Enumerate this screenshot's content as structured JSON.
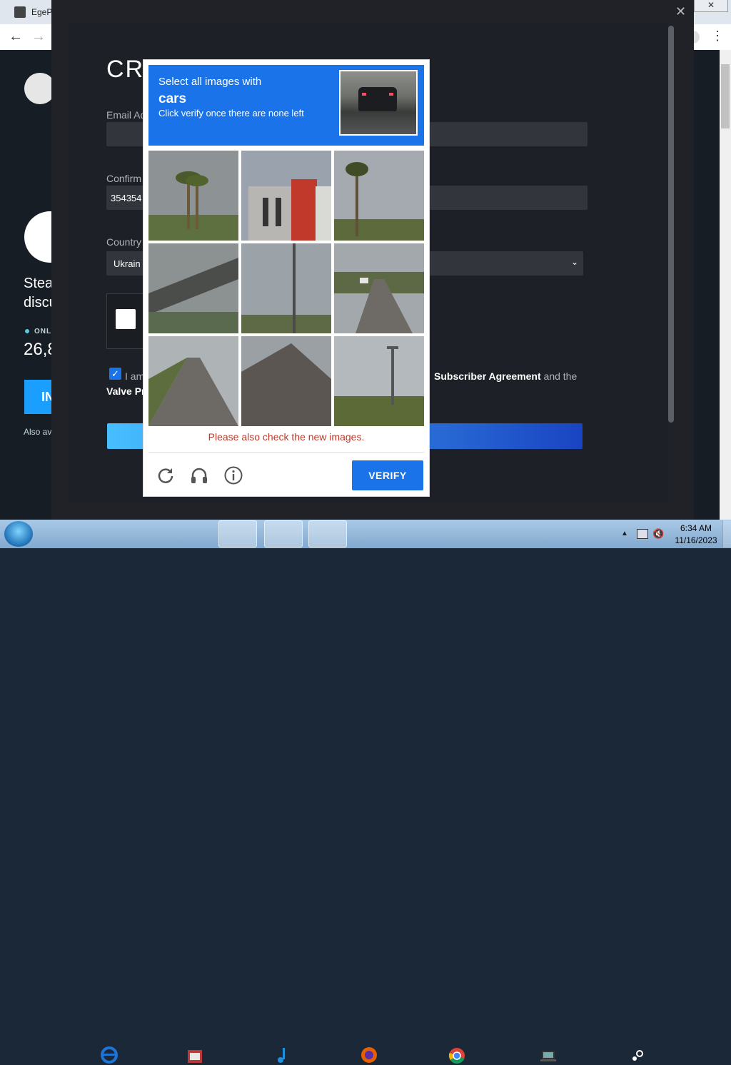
{
  "browser": {
    "tab_title": "EgeP",
    "window_close": "✕"
  },
  "steam_page": {
    "left_heading_1": "Stea",
    "left_heading_2": "discu",
    "online_label": "ONLI",
    "online_count": "26,8",
    "install_label": "IN",
    "also_text": "Also av"
  },
  "create_form": {
    "title": "CRE",
    "email_label": "Email Ad",
    "confirm_label": "Confirm",
    "confirm_value": "354354",
    "country_label": "Country",
    "country_value": "Ukrain",
    "agree_text": "I am",
    "agree_link_1": "Subscriber Agreement",
    "agree_and_the": "and the",
    "valve_text": "Valve Pr"
  },
  "captcha": {
    "prompt_line1": "Select all images with",
    "prompt_keyword": "cars",
    "prompt_line3": "Click verify once there are none left",
    "warning": "Please also check the new images.",
    "verify_label": "VERIFY",
    "icons": [
      "refresh-icon",
      "audio-icon",
      "info-icon"
    ],
    "tiles": [
      {
        "name": "palm-trees"
      },
      {
        "name": "building"
      },
      {
        "name": "palm-tree"
      },
      {
        "name": "overpass"
      },
      {
        "name": "utility-pole"
      },
      {
        "name": "road-with-car"
      },
      {
        "name": "empty-road"
      },
      {
        "name": "roof"
      },
      {
        "name": "street-lamp"
      }
    ],
    "header_color": "#1a73e8",
    "warning_color": "#c0392b"
  },
  "taskbar": {
    "apps": [
      "start-orb",
      "internet-explorer",
      "app-store",
      "itunes",
      "firefox",
      "chrome",
      "laptop-app",
      "steam"
    ],
    "clock_time": "6:34 AM",
    "clock_date": "11/16/2023"
  }
}
